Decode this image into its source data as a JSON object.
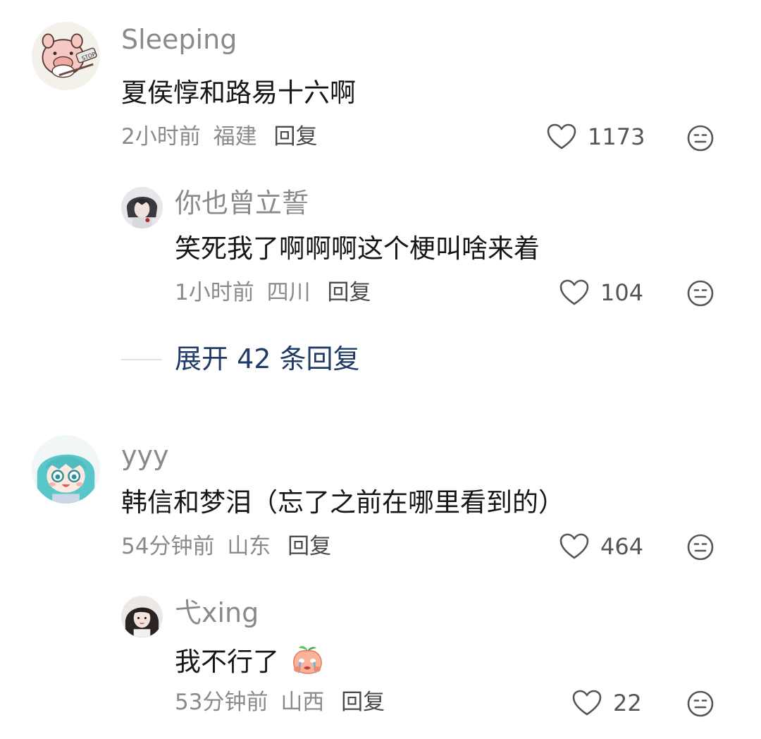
{
  "comments": [
    {
      "username": "Sleeping",
      "content": "夏侯惇和路易十六啊",
      "time": "2小时前",
      "location": "福建",
      "reply_label": "回复",
      "likes": "1173"
    },
    {
      "username": "你也曾立誓",
      "content": "笑死我了啊啊啊这个梗叫啥来着",
      "time": "1小时前",
      "location": "四川",
      "reply_label": "回复",
      "likes": "104"
    },
    {
      "username": "yyy",
      "content": "韩信和梦泪（忘了之前在哪里看到的）",
      "time": "54分钟前",
      "location": "山东",
      "reply_label": "回复",
      "likes": "464"
    },
    {
      "username": "弋xing",
      "content": "我不行了",
      "time": "53分钟前",
      "location": "山西",
      "reply_label": "回复",
      "likes": "22"
    }
  ],
  "expand_replies": "展开 42 条回复",
  "icons": {
    "like": "heart-outline-icon",
    "dislike": "meh-face-icon",
    "emoji": "crying-peach-emoji"
  },
  "colors": {
    "username": "#8a8a8a",
    "content": "#161616",
    "meta": "#8a8a8a",
    "expand_link": "#1f3b66"
  }
}
